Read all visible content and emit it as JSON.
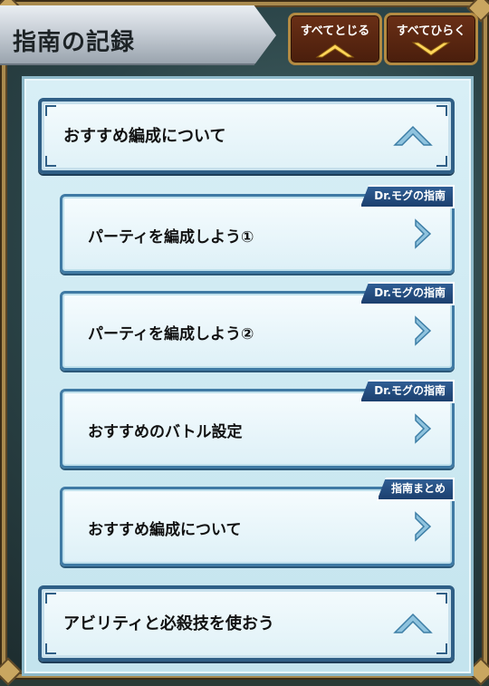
{
  "header": {
    "title": "指南の記録",
    "collapse_all_label": "すべてとじる",
    "expand_all_label": "すべてひらく"
  },
  "sections": [
    {
      "label": "おすすめ編成について",
      "state": "expanded"
    },
    {
      "label": "アビリティと必殺技を使おう",
      "state": "expanded"
    }
  ],
  "items": [
    {
      "label": "パーティを編成しよう①",
      "tag": "Dr.モグの指南"
    },
    {
      "label": "パーティを編成しよう②",
      "tag": "Dr.モグの指南"
    },
    {
      "label": "おすすめのバトル設定",
      "tag": "Dr.モグの指南"
    },
    {
      "label": "おすすめ編成について",
      "tag": "指南まとめ"
    }
  ],
  "colors": {
    "frame_gold": "#a98a4e",
    "panel_bg": "#d8eff6",
    "section_border": "#2f5f86",
    "tag_bg": "#1c3f6e",
    "chevron": "#7fb6d6"
  },
  "icons": {
    "collapse": "chevron-up-icon",
    "expand": "chevron-down-icon",
    "open_item": "chevron-right-icon"
  }
}
